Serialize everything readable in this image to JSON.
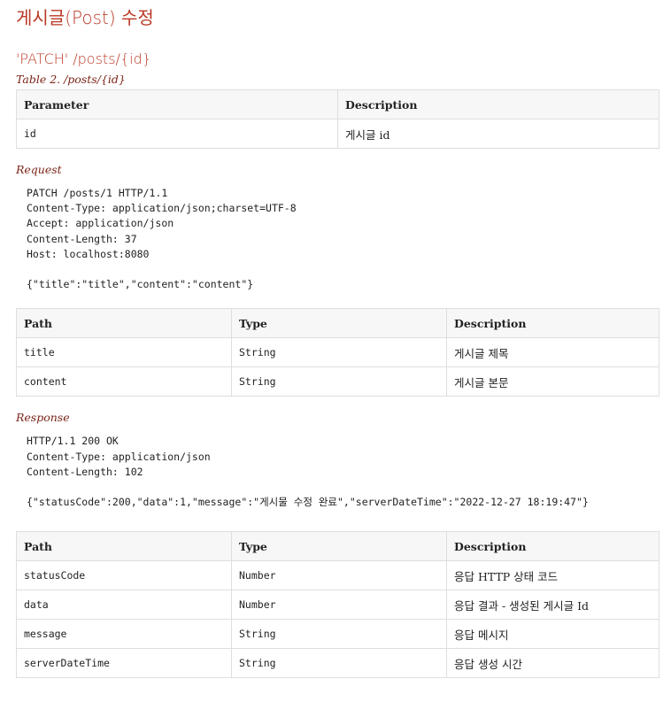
{
  "section_title": "게시글(Post) 수정",
  "endpoint": "'PATCH' /posts/{id}",
  "path_params": {
    "caption": "Table 2. /posts/{id}",
    "headers": [
      "Parameter",
      "Description"
    ],
    "rows": [
      [
        "id",
        "게시글 id"
      ]
    ]
  },
  "request": {
    "title": "Request",
    "lines": [
      "PATCH /posts/1 HTTP/1.1",
      "Content-Type: application/json;charset=UTF-8",
      "Accept: application/json",
      "Content-Length: 37",
      "Host: localhost:8080",
      "",
      "{\"title\":\"title\",\"content\":\"content\"}"
    ],
    "fields": {
      "headers": [
        "Path",
        "Type",
        "Description"
      ],
      "rows": [
        [
          "title",
          "String",
          "게시글 제목"
        ],
        [
          "content",
          "String",
          "게시글 본문"
        ]
      ]
    }
  },
  "response": {
    "title": "Response",
    "lines": [
      "HTTP/1.1 200 OK",
      "Content-Type: application/json",
      "Content-Length: 102",
      "",
      "{\"statusCode\":200,\"data\":1,\"message\":\"게시물 수정 완료\",\"serverDateTime\":\"2022-12-27 18:19:47\"}"
    ],
    "fields": {
      "headers": [
        "Path",
        "Type",
        "Description"
      ],
      "rows": [
        [
          "statusCode",
          "Number",
          "응답 HTTP 상태 코드"
        ],
        [
          "data",
          "Number",
          "응답 결과 - 생성된 게시글 Id"
        ],
        [
          "message",
          "String",
          "응답 메시지"
        ],
        [
          "serverDateTime",
          "String",
          "응답 생성 시간"
        ]
      ]
    }
  }
}
